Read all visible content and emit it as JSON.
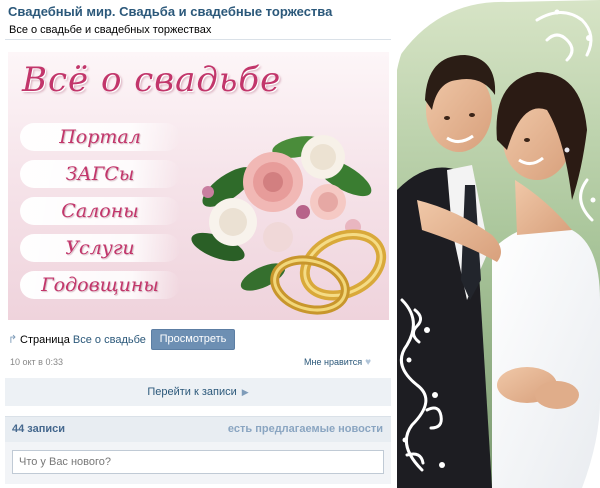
{
  "header": {
    "title": "Свадебный мир. Свадьба и свадебные торжества",
    "subtitle": "Все о свадьбе и свадебных торжествах"
  },
  "banner": {
    "title": "Всё о свадьбе",
    "menu": [
      "Портал",
      "ЗАГСы",
      "Салоны",
      "Услуги",
      "Годовщины"
    ]
  },
  "post": {
    "page_prefix": "Страница",
    "page_link": "Все о свадьбе",
    "view_button": "Просмотреть",
    "date": "10 окт в 0:33",
    "like_label": "Мне нравится"
  },
  "goto_post": "Перейти к записи",
  "wall": {
    "count": "44 записи",
    "suggested_news": "есть предлагаемые новости"
  },
  "composer": {
    "placeholder": "Что у Вас нового?"
  },
  "colors": {
    "link": "#2b587a",
    "button": "#6d8fb3",
    "banner_text": "#c2366b"
  }
}
